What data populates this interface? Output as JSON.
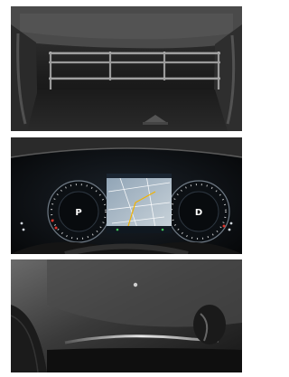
{
  "photos": [
    {
      "id": "trunk",
      "subject": "cargo-area-photo"
    },
    {
      "id": "cluster",
      "subject": "instrument-cluster-photo"
    },
    {
      "id": "door",
      "subject": "door-trim-photo"
    }
  ],
  "cluster": {
    "left_gauge_gear": "P",
    "right_gauge_gear": "D"
  }
}
